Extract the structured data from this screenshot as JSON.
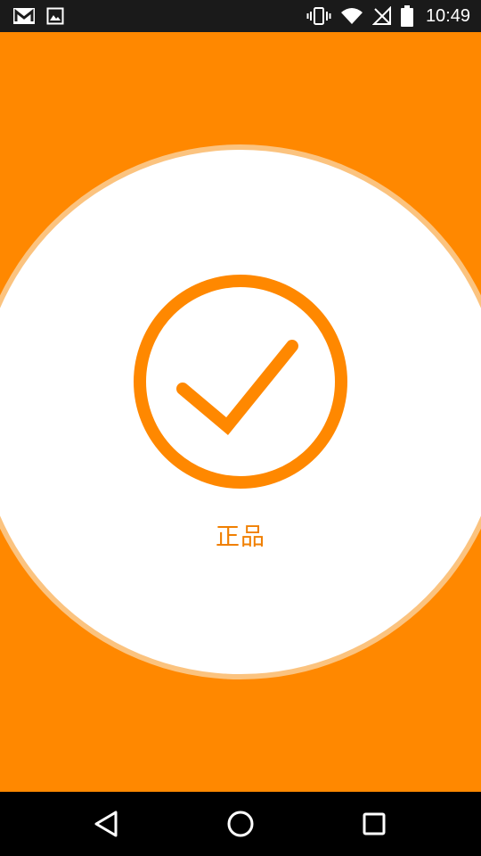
{
  "status_bar": {
    "time": "10:49",
    "left_icons": [
      "gmail-icon",
      "image-icon"
    ],
    "right_icons": [
      "vibrate-icon",
      "wifi-icon",
      "no-signal-icon",
      "battery-icon"
    ]
  },
  "result": {
    "label": "正品",
    "icon": "check-circle-icon"
  },
  "colors": {
    "background": "#ff8800",
    "accent": "#ff8800",
    "ring": "#fbc37f",
    "label": "#f07f00"
  },
  "nav_bar": {
    "buttons": [
      "back-icon",
      "home-icon",
      "recents-icon"
    ]
  }
}
